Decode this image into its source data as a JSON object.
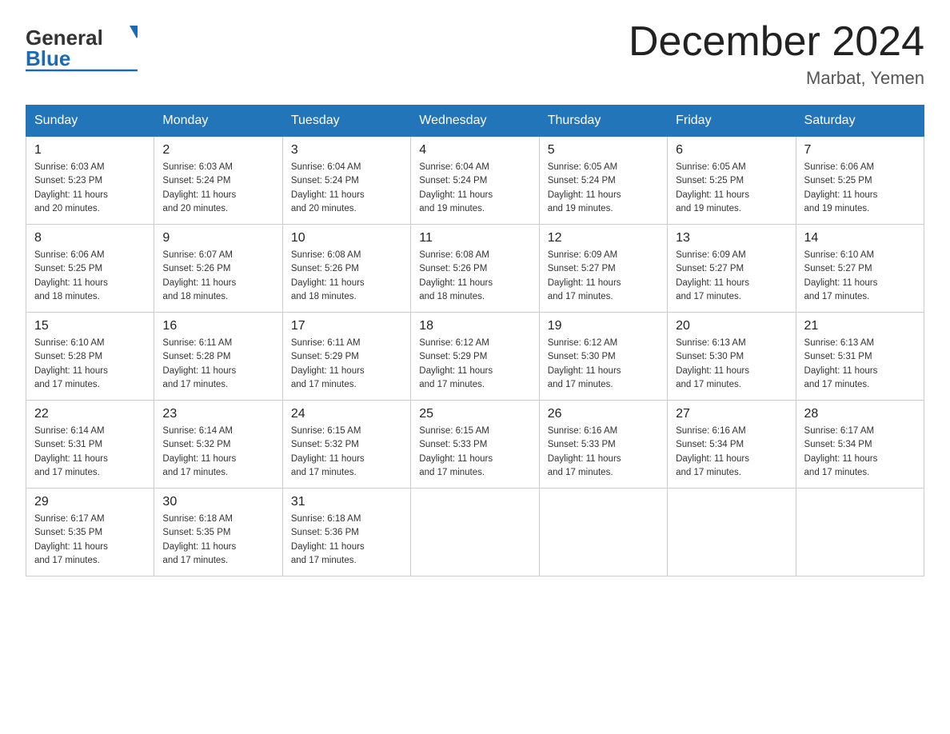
{
  "header": {
    "logo_general": "General",
    "logo_blue": "Blue",
    "title": "December 2024",
    "location": "Marbat, Yemen"
  },
  "weekdays": [
    "Sunday",
    "Monday",
    "Tuesday",
    "Wednesday",
    "Thursday",
    "Friday",
    "Saturday"
  ],
  "weeks": [
    [
      {
        "day": "1",
        "sunrise": "6:03 AM",
        "sunset": "5:23 PM",
        "daylight": "11 hours and 20 minutes."
      },
      {
        "day": "2",
        "sunrise": "6:03 AM",
        "sunset": "5:24 PM",
        "daylight": "11 hours and 20 minutes."
      },
      {
        "day": "3",
        "sunrise": "6:04 AM",
        "sunset": "5:24 PM",
        "daylight": "11 hours and 20 minutes."
      },
      {
        "day": "4",
        "sunrise": "6:04 AM",
        "sunset": "5:24 PM",
        "daylight": "11 hours and 19 minutes."
      },
      {
        "day": "5",
        "sunrise": "6:05 AM",
        "sunset": "5:24 PM",
        "daylight": "11 hours and 19 minutes."
      },
      {
        "day": "6",
        "sunrise": "6:05 AM",
        "sunset": "5:25 PM",
        "daylight": "11 hours and 19 minutes."
      },
      {
        "day": "7",
        "sunrise": "6:06 AM",
        "sunset": "5:25 PM",
        "daylight": "11 hours and 19 minutes."
      }
    ],
    [
      {
        "day": "8",
        "sunrise": "6:06 AM",
        "sunset": "5:25 PM",
        "daylight": "11 hours and 18 minutes."
      },
      {
        "day": "9",
        "sunrise": "6:07 AM",
        "sunset": "5:26 PM",
        "daylight": "11 hours and 18 minutes."
      },
      {
        "day": "10",
        "sunrise": "6:08 AM",
        "sunset": "5:26 PM",
        "daylight": "11 hours and 18 minutes."
      },
      {
        "day": "11",
        "sunrise": "6:08 AM",
        "sunset": "5:26 PM",
        "daylight": "11 hours and 18 minutes."
      },
      {
        "day": "12",
        "sunrise": "6:09 AM",
        "sunset": "5:27 PM",
        "daylight": "11 hours and 17 minutes."
      },
      {
        "day": "13",
        "sunrise": "6:09 AM",
        "sunset": "5:27 PM",
        "daylight": "11 hours and 17 minutes."
      },
      {
        "day": "14",
        "sunrise": "6:10 AM",
        "sunset": "5:27 PM",
        "daylight": "11 hours and 17 minutes."
      }
    ],
    [
      {
        "day": "15",
        "sunrise": "6:10 AM",
        "sunset": "5:28 PM",
        "daylight": "11 hours and 17 minutes."
      },
      {
        "day": "16",
        "sunrise": "6:11 AM",
        "sunset": "5:28 PM",
        "daylight": "11 hours and 17 minutes."
      },
      {
        "day": "17",
        "sunrise": "6:11 AM",
        "sunset": "5:29 PM",
        "daylight": "11 hours and 17 minutes."
      },
      {
        "day": "18",
        "sunrise": "6:12 AM",
        "sunset": "5:29 PM",
        "daylight": "11 hours and 17 minutes."
      },
      {
        "day": "19",
        "sunrise": "6:12 AM",
        "sunset": "5:30 PM",
        "daylight": "11 hours and 17 minutes."
      },
      {
        "day": "20",
        "sunrise": "6:13 AM",
        "sunset": "5:30 PM",
        "daylight": "11 hours and 17 minutes."
      },
      {
        "day": "21",
        "sunrise": "6:13 AM",
        "sunset": "5:31 PM",
        "daylight": "11 hours and 17 minutes."
      }
    ],
    [
      {
        "day": "22",
        "sunrise": "6:14 AM",
        "sunset": "5:31 PM",
        "daylight": "11 hours and 17 minutes."
      },
      {
        "day": "23",
        "sunrise": "6:14 AM",
        "sunset": "5:32 PM",
        "daylight": "11 hours and 17 minutes."
      },
      {
        "day": "24",
        "sunrise": "6:15 AM",
        "sunset": "5:32 PM",
        "daylight": "11 hours and 17 minutes."
      },
      {
        "day": "25",
        "sunrise": "6:15 AM",
        "sunset": "5:33 PM",
        "daylight": "11 hours and 17 minutes."
      },
      {
        "day": "26",
        "sunrise": "6:16 AM",
        "sunset": "5:33 PM",
        "daylight": "11 hours and 17 minutes."
      },
      {
        "day": "27",
        "sunrise": "6:16 AM",
        "sunset": "5:34 PM",
        "daylight": "11 hours and 17 minutes."
      },
      {
        "day": "28",
        "sunrise": "6:17 AM",
        "sunset": "5:34 PM",
        "daylight": "11 hours and 17 minutes."
      }
    ],
    [
      {
        "day": "29",
        "sunrise": "6:17 AM",
        "sunset": "5:35 PM",
        "daylight": "11 hours and 17 minutes."
      },
      {
        "day": "30",
        "sunrise": "6:18 AM",
        "sunset": "5:35 PM",
        "daylight": "11 hours and 17 minutes."
      },
      {
        "day": "31",
        "sunrise": "6:18 AM",
        "sunset": "5:36 PM",
        "daylight": "11 hours and 17 minutes."
      },
      null,
      null,
      null,
      null
    ]
  ],
  "labels": {
    "sunrise": "Sunrise:",
    "sunset": "Sunset:",
    "daylight": "Daylight:"
  }
}
